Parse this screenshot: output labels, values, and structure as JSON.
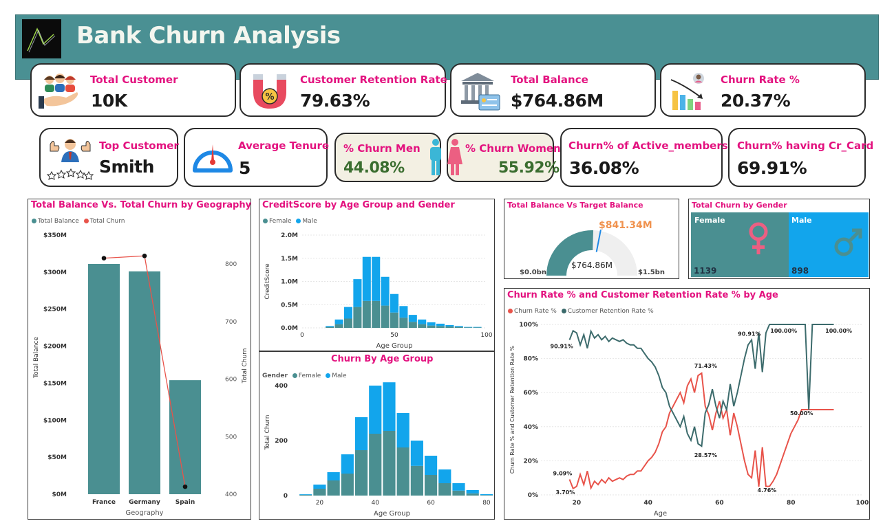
{
  "header": {
    "title": "Bank Churn Analysis"
  },
  "kpis": {
    "total_customer": {
      "label": "Total Customer",
      "value": "10K",
      "icon": "customers-hand-icon"
    },
    "retention": {
      "label": "Customer Retention Rate %",
      "value": "79.63%",
      "icon": "magnet-icon"
    },
    "total_balance": {
      "label": "Total Balance",
      "value": "$764.86M",
      "icon": "bank-icon"
    },
    "churn_rate": {
      "label": "Churn Rate %",
      "value": "20.37%",
      "icon": "declining-chart-icon"
    },
    "top_customer": {
      "label": "Top Customer",
      "value": "Smith",
      "icon": "thumbs-up-stars-icon"
    },
    "avg_tenure": {
      "label": "Average Tenure",
      "value": "5",
      "icon": "gauge-icon"
    },
    "churn_men": {
      "label": "% Churn Men",
      "value": "44.08%",
      "icon": "man-icon"
    },
    "churn_women": {
      "label": "% Churn Women",
      "value": "55.92%",
      "icon": "woman-icon"
    },
    "churn_active": {
      "label": "Churn% of Active_members",
      "value": "36.08%"
    },
    "churn_crcard": {
      "label": "Churn% having Cr_Card",
      "value": "69.91%"
    }
  },
  "colors": {
    "teal": "#4a8f91",
    "blue": "#12a5ec",
    "red": "#e8534a",
    "dark_teal": "#3c6b6c",
    "pink": "#e3127f",
    "orange": "#f0924e"
  },
  "geo": {
    "title": "Total Balance Vs. Total Churn by Geography",
    "legend": [
      "Total Balance",
      "Total Churn"
    ],
    "xlabel": "Geography",
    "ylabel_left": "Total Balance",
    "ylabel_right": "Total Churn",
    "left_ticks": [
      "$0M",
      "$50M",
      "$100M",
      "$150M",
      "$200M",
      "$250M",
      "$300M",
      "$350M"
    ],
    "right_ticks": [
      "400",
      "500",
      "600",
      "700",
      "800"
    ]
  },
  "credit": {
    "title": "CreditScore by Age Group and Gender",
    "legend": [
      "Female",
      "Male"
    ],
    "xlabel": "Age Group",
    "ylabel": "CreditScore",
    "y_ticks": [
      "0.0M",
      "0.5M",
      "1.0M",
      "1.5M",
      "2.0M"
    ],
    "x_ticks": [
      "0",
      "50",
      "100"
    ]
  },
  "age_churn": {
    "title": "Churn By Age Group",
    "legend_title": "Gender",
    "legend": [
      "Female",
      "Male"
    ],
    "xlabel": "Age Group",
    "ylabel": "Total Churn",
    "y_ticks": [
      "0",
      "200",
      "400"
    ],
    "x_ticks": [
      "20",
      "40",
      "60",
      "80"
    ]
  },
  "gauge": {
    "title": "Total Balance Vs Target Balance",
    "target": "$841.34M",
    "value_label": "$764.86M",
    "min": "$0.0bn",
    "max": "$1.5bn"
  },
  "gender": {
    "title": "Total Churn by Gender",
    "female_label": "Female",
    "female_value": "1139",
    "male_label": "Male",
    "male_value": "898"
  },
  "rate": {
    "title": "Churn Rate % and Customer Retention Rate % by Age",
    "legend": [
      "Churn Rate %",
      "Customer Retention Rate %"
    ],
    "xlabel": "Age",
    "ylabel": "Churn Rate % and Customer Retention Rate %",
    "y_ticks": [
      "0%",
      "20%",
      "40%",
      "60%",
      "80%",
      "100%"
    ],
    "x_ticks": [
      "20",
      "40",
      "60",
      "80",
      "100"
    ],
    "annotations": [
      "90.91%",
      "9.09%",
      "3.70%",
      "71.43%",
      "28.57%",
      "90.91%",
      "100.00%",
      "100.00%",
      "4.76%",
      "50.00%"
    ]
  },
  "chart_data": [
    {
      "type": "bar",
      "title": "Total Balance Vs. Total Churn by Geography",
      "categories": [
        "France",
        "Germany",
        "Spain"
      ],
      "series": [
        {
          "name": "Total Balance",
          "axis": "left",
          "values": [
            311,
            301,
            154
          ]
        },
        {
          "name": "Total Churn",
          "type": "line",
          "axis": "right",
          "values": [
            810,
            814,
            413
          ]
        }
      ],
      "ylim_left": [
        0,
        350
      ],
      "ylim_right": [
        400,
        800
      ]
    },
    {
      "type": "bar",
      "title": "CreditScore by Age Group and Gender",
      "stacked": true,
      "x": [
        15,
        20,
        25,
        30,
        35,
        40,
        45,
        50,
        55,
        60,
        65,
        70,
        75,
        80,
        85,
        90,
        95
      ],
      "series": [
        {
          "name": "Female",
          "values": [
            0.02,
            0.08,
            0.2,
            0.45,
            0.58,
            0.58,
            0.48,
            0.33,
            0.22,
            0.13,
            0.08,
            0.05,
            0.04,
            0.03,
            0.02,
            0.01,
            0.01
          ]
        },
        {
          "name": "Male",
          "values": [
            0.02,
            0.1,
            0.25,
            0.6,
            0.95,
            0.95,
            0.62,
            0.4,
            0.25,
            0.15,
            0.1,
            0.07,
            0.05,
            0.03,
            0.02,
            0.01,
            0.01
          ]
        }
      ],
      "ylim": [
        0,
        2.0
      ],
      "xlim": [
        0,
        100
      ]
    },
    {
      "type": "bar",
      "title": "Churn By Age Group",
      "stacked": true,
      "x": [
        15,
        20,
        25,
        30,
        35,
        40,
        45,
        50,
        55,
        60,
        65,
        70,
        75,
        80
      ],
      "series": [
        {
          "name": "Female",
          "values": [
            3,
            25,
            55,
            80,
            165,
            225,
            235,
            175,
            108,
            75,
            45,
            18,
            8,
            2
          ]
        },
        {
          "name": "Male",
          "values": [
            2,
            15,
            30,
            70,
            120,
            175,
            177,
            125,
            92,
            70,
            50,
            27,
            12,
            3
          ]
        }
      ],
      "ylim": [
        0,
        460
      ],
      "xlim": [
        10,
        82
      ]
    },
    {
      "type": "gauge",
      "title": "Total Balance Vs Target Balance",
      "value": 764.86,
      "target": 841.34,
      "min": 0,
      "max": 1500
    },
    {
      "type": "treemap",
      "title": "Total Churn by Gender",
      "categories": [
        "Female",
        "Male"
      ],
      "values": [
        1139,
        898
      ]
    },
    {
      "type": "line",
      "title": "Churn Rate % and Customer Retention Rate % by Age",
      "x": [
        18,
        19,
        20,
        21,
        22,
        23,
        24,
        25,
        26,
        27,
        28,
        29,
        30,
        31,
        32,
        33,
        34,
        35,
        36,
        37,
        38,
        39,
        40,
        41,
        42,
        43,
        44,
        45,
        46,
        47,
        48,
        49,
        50,
        51,
        52,
        53,
        54,
        55,
        56,
        57,
        58,
        59,
        60,
        61,
        62,
        63,
        64,
        65,
        66,
        67,
        68,
        69,
        70,
        71,
        72,
        73,
        74,
        75,
        76,
        77,
        78,
        79,
        80,
        81,
        82,
        83,
        84,
        85,
        86,
        87,
        88,
        89,
        90,
        91,
        92
      ],
      "series": [
        {
          "name": "Churn Rate %",
          "values": [
            9.09,
            3.7,
            5,
            12,
            6,
            14,
            4,
            8,
            6,
            9,
            7,
            10,
            8,
            9,
            10,
            9,
            11,
            12,
            12,
            14,
            14,
            17,
            20,
            22,
            25,
            30,
            37,
            40,
            48,
            52,
            56,
            60,
            54,
            64,
            68,
            60,
            70,
            71.43,
            52,
            47,
            38,
            48,
            55,
            45,
            50,
            35,
            48,
            40,
            30,
            20,
            12,
            10,
            26,
            4.76,
            28,
            5,
            5,
            8,
            12,
            18,
            24,
            30,
            36,
            40,
            44,
            50,
            50,
            50,
            50,
            50,
            50,
            50,
            50,
            50,
            50
          ]
        },
        {
          "name": "Customer Retention Rate %",
          "values": [
            90.91,
            96.3,
            95,
            88,
            94,
            86,
            96,
            92,
            94,
            91,
            93,
            90,
            92,
            91,
            90,
            91,
            89,
            88,
            88,
            86,
            86,
            83,
            80,
            78,
            75,
            70,
            63,
            60,
            52,
            48,
            44,
            40,
            46,
            36,
            32,
            40,
            30,
            28.57,
            48,
            53,
            62,
            52,
            45,
            55,
            50,
            65,
            52,
            60,
            70,
            80,
            88,
            90.91,
            74,
            95.24,
            72,
            95,
            100,
            100,
            100,
            100,
            100,
            100,
            100,
            100,
            100,
            100,
            100,
            50,
            100,
            100,
            100,
            100,
            100,
            100,
            100
          ]
        }
      ],
      "ylim": [
        0,
        100
      ],
      "xlim": [
        10,
        100
      ]
    }
  ]
}
